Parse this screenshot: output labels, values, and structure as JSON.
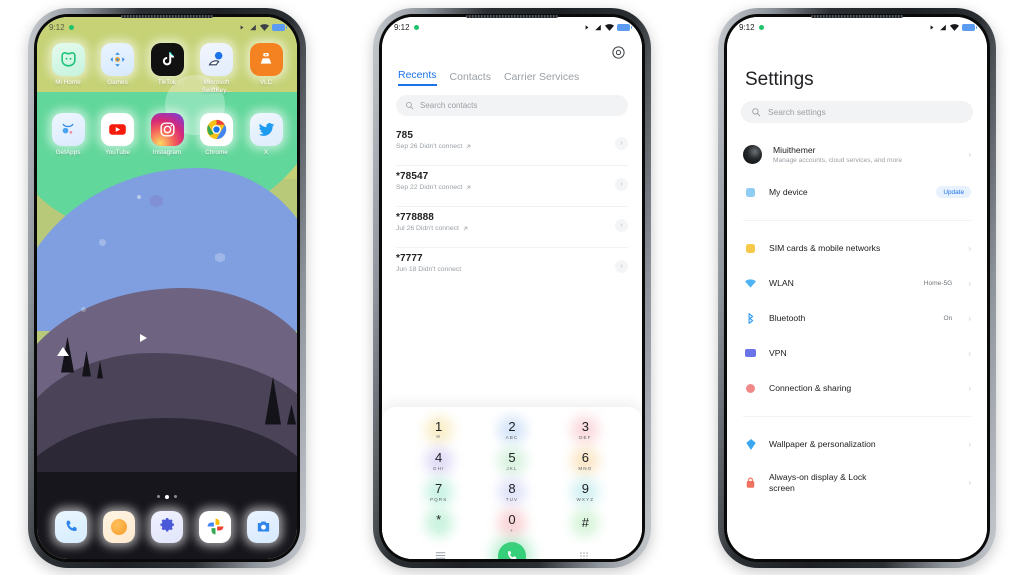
{
  "meta": {
    "background": "#ffffff",
    "accent_blue": "#1a73e8",
    "call_green": "#37d07a"
  },
  "phone_home": {
    "status": {
      "time": "9:12",
      "recording_dot": "green-dot",
      "icons": [
        "bluetooth-icon",
        "signal-icon",
        "wifi-icon",
        "battery-icon"
      ]
    },
    "app_rows": [
      [
        {
          "label": "Mi Home",
          "icon": "mi-home-icon"
        },
        {
          "label": "Games",
          "icon": "games-icon"
        },
        {
          "label": "TikTok",
          "icon": "tiktok-icon"
        },
        {
          "label": "Microsoft SwiftKey...",
          "icon": "swiftkey-icon"
        },
        {
          "label": "VLC",
          "icon": "vlc-icon"
        }
      ],
      [
        {
          "label": "GetApps",
          "icon": "getapps-icon"
        },
        {
          "label": "YouTube",
          "icon": "youtube-icon"
        },
        {
          "label": "Instagram",
          "icon": "instagram-icon"
        },
        {
          "label": "Chrome",
          "icon": "chrome-icon"
        },
        {
          "label": "X",
          "icon": "x-twitter-icon"
        }
      ]
    ],
    "page_dots": {
      "count": 3,
      "active_index": 1
    },
    "dock": [
      {
        "label": "Phone",
        "icon": "phone-icon"
      },
      {
        "label": "Browser",
        "icon": "browser-icon"
      },
      {
        "label": "Settings",
        "icon": "gear-icon"
      },
      {
        "label": "Photos",
        "icon": "google-photos-icon"
      },
      {
        "label": "Camera",
        "icon": "camera-icon"
      }
    ]
  },
  "phone_dialer": {
    "status": {
      "time": "9:12"
    },
    "settings_icon": "gear-icon",
    "tabs": [
      {
        "label": "Recents",
        "active": true
      },
      {
        "label": "Contacts",
        "active": false
      },
      {
        "label": "Carrier Services",
        "active": false
      }
    ],
    "search": {
      "placeholder": "Search contacts",
      "value": "",
      "icon": "search-icon"
    },
    "calls": [
      {
        "number": "785",
        "detail": "Sep 26 Didn't connect",
        "type_icon": "outgoing-call-arrow"
      },
      {
        "number": "*78547",
        "detail": "Sep 22 Didn't connect",
        "type_icon": "outgoing-call-arrow"
      },
      {
        "number": "*778888",
        "detail": "Jul 26 Didn't connect",
        "type_icon": "outgoing-call-arrow"
      },
      {
        "number": "*7777",
        "detail": "Jun 18 Didn't connect",
        "type_icon": "outgoing-call-arrow"
      }
    ],
    "keypad": [
      {
        "digit": "1",
        "sub": "✉",
        "glow": "#f5e4a8"
      },
      {
        "digit": "2",
        "sub": "ABC",
        "glow": "#bcd5f5"
      },
      {
        "digit": "3",
        "sub": "DEF",
        "glow": "#f7c3c9"
      },
      {
        "digit": "4",
        "sub": "GHI",
        "glow": "#cfc6f2"
      },
      {
        "digit": "5",
        "sub": "JKL",
        "glow": "#bfeacb"
      },
      {
        "digit": "6",
        "sub": "MNO",
        "glow": "#f8d8a5"
      },
      {
        "digit": "7",
        "sub": "PQRS",
        "glow": "#a9ecd4"
      },
      {
        "digit": "8",
        "sub": "TUV",
        "glow": "#cdd2f4"
      },
      {
        "digit": "9",
        "sub": "WXYZ",
        "glow": "#b9e8ea"
      },
      {
        "digit": "*",
        "sub": ".",
        "glow": "#a9ecc9"
      },
      {
        "digit": "0",
        "sub": "+",
        "glow": "#f7b9bd"
      },
      {
        "digit": "#",
        "sub": "",
        "glow": "#bfeec4"
      }
    ],
    "bottom_bar": {
      "menu_icon": "hamburger-menu-icon",
      "call_icon": "call-handset-icon",
      "keypad_icon": "dialpad-icon"
    }
  },
  "phone_settings": {
    "status": {
      "time": "9:12"
    },
    "title": "Settings",
    "search": {
      "placeholder": "Search settings",
      "value": "",
      "icon": "search-icon"
    },
    "account": {
      "name": "Miuithemer",
      "subtitle": "Manage accounts, cloud services, and more",
      "avatar": "user-avatar"
    },
    "device": {
      "label": "My device",
      "badge": "Update",
      "icon": "device-icon",
      "icon_color": "#8fcdf5"
    },
    "groups": [
      [
        {
          "label": "SIM cards & mobile networks",
          "value": "",
          "icon": "sim-card-icon",
          "icon_color": "#f7c948"
        },
        {
          "label": "WLAN",
          "value": "Home-5G",
          "icon": "wifi-icon",
          "icon_color": "#4eb3f5"
        },
        {
          "label": "Bluetooth",
          "value": "On",
          "icon": "bluetooth-icon",
          "icon_color": "#2f9bf5"
        },
        {
          "label": "VPN",
          "value": "",
          "icon": "vpn-icon",
          "icon_color": "#6b74e8"
        },
        {
          "label": "Connection & sharing",
          "value": "",
          "icon": "share-icon",
          "icon_color": "#f08a8a"
        }
      ],
      [
        {
          "label": "Wallpaper & personalization",
          "value": "",
          "icon": "wallpaper-icon",
          "icon_color": "#3aa8f0"
        },
        {
          "label": "Always-on display & Lock screen",
          "value": "",
          "icon": "lock-icon",
          "icon_color": "#f0715e"
        }
      ]
    ]
  }
}
